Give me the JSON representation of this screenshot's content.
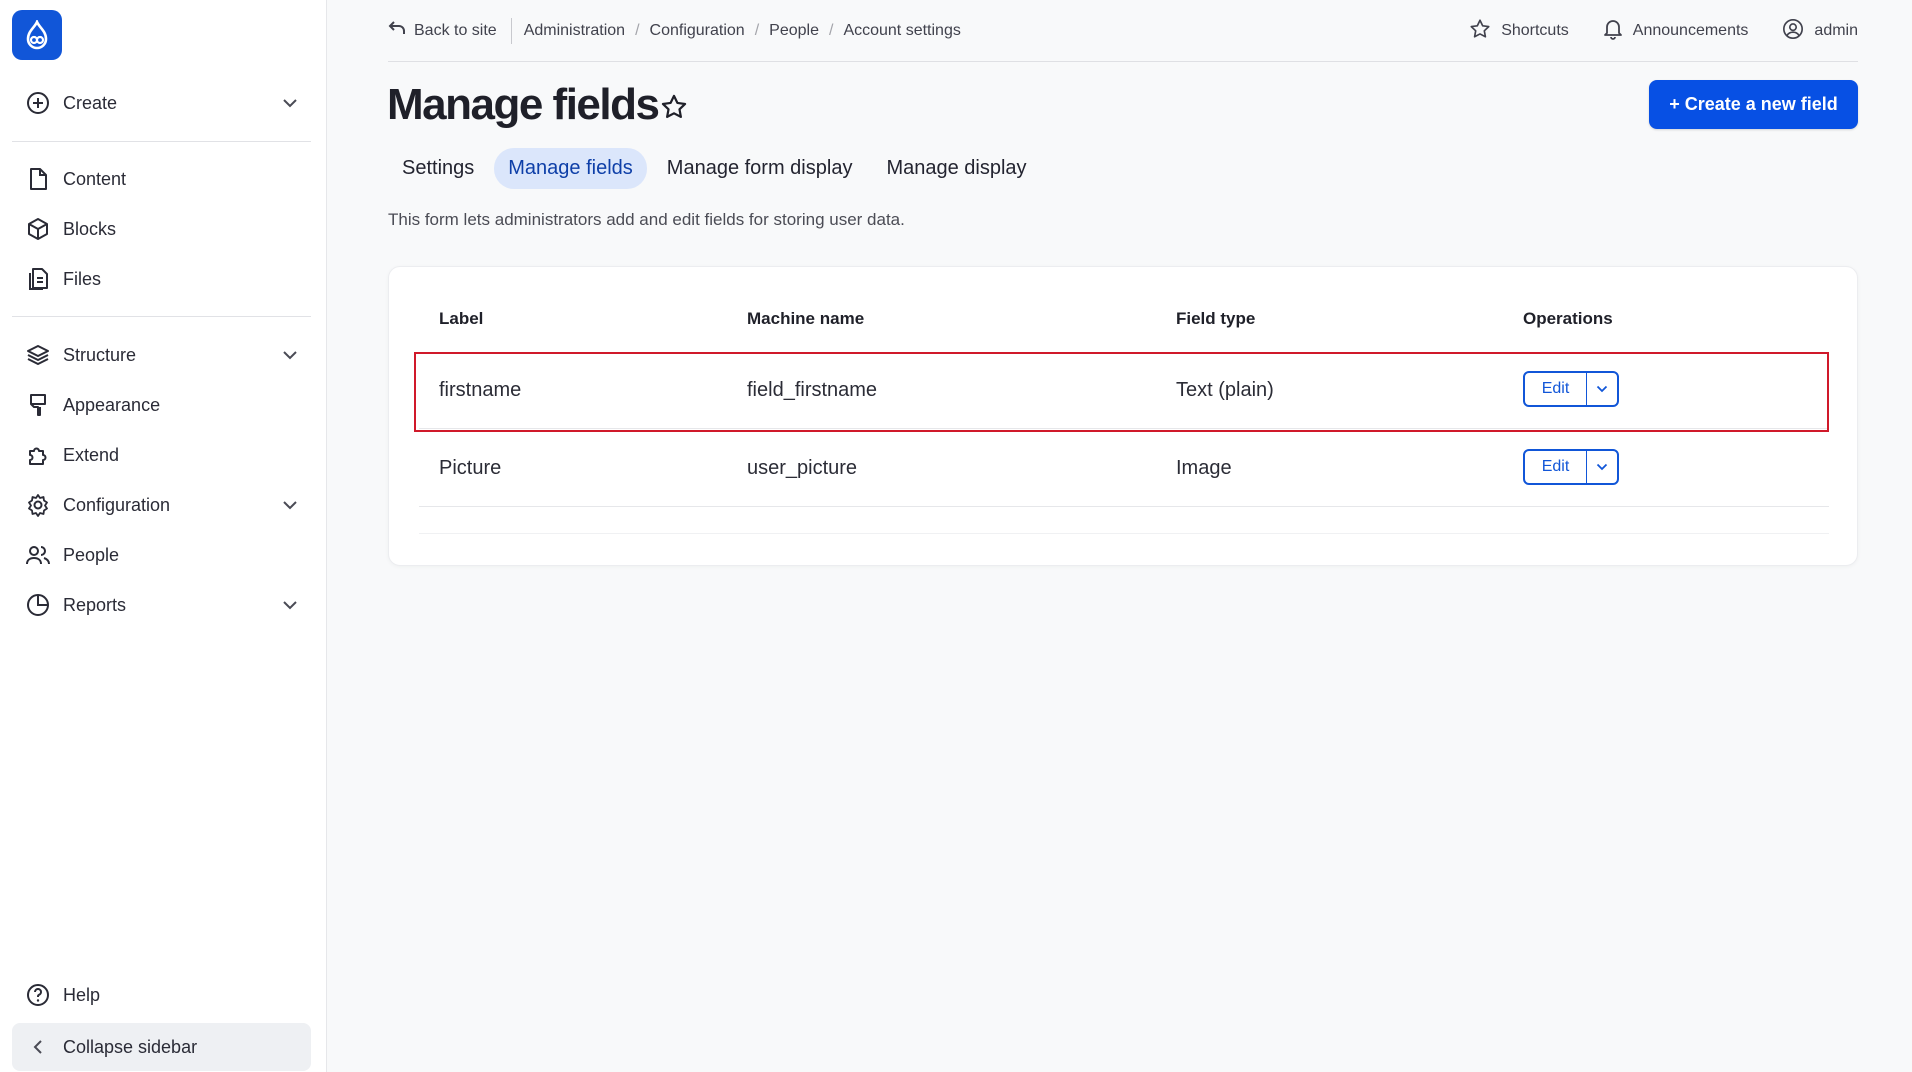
{
  "sidebar": {
    "create": "Create",
    "items": {
      "content": "Content",
      "blocks": "Blocks",
      "files": "Files",
      "structure": "Structure",
      "appearance": "Appearance",
      "extend": "Extend",
      "configuration": "Configuration",
      "people": "People",
      "reports": "Reports"
    },
    "help": "Help",
    "collapse": "Collapse sidebar"
  },
  "topbar": {
    "back": "Back to site",
    "breadcrumb": [
      "Administration",
      "Configuration",
      "People",
      "Account settings"
    ],
    "breadcrumb_sep": "/",
    "shortcuts": "Shortcuts",
    "announcements": "Announcements",
    "user": "admin"
  },
  "page": {
    "title": "Manage fields",
    "create_button": "+ Create a new field",
    "description": "This form lets administrators add and edit fields for storing user data."
  },
  "tabs": [
    {
      "label": "Settings",
      "active": false
    },
    {
      "label": "Manage fields",
      "active": true
    },
    {
      "label": "Manage form display",
      "active": false
    },
    {
      "label": "Manage display",
      "active": false
    }
  ],
  "table": {
    "headers": [
      "Label",
      "Machine name",
      "Field type",
      "Operations"
    ],
    "rows": [
      {
        "label": "firstname",
        "machine_name": "field_firstname",
        "field_type": "Text (plain)",
        "operation": "Edit"
      },
      {
        "label": "Picture",
        "machine_name": "user_picture",
        "field_type": "Image",
        "operation": "Edit"
      }
    ]
  },
  "colors": {
    "accent": "#0750e4",
    "highlight": "#d0192a",
    "tab_active_bg": "#dbe6fb"
  }
}
